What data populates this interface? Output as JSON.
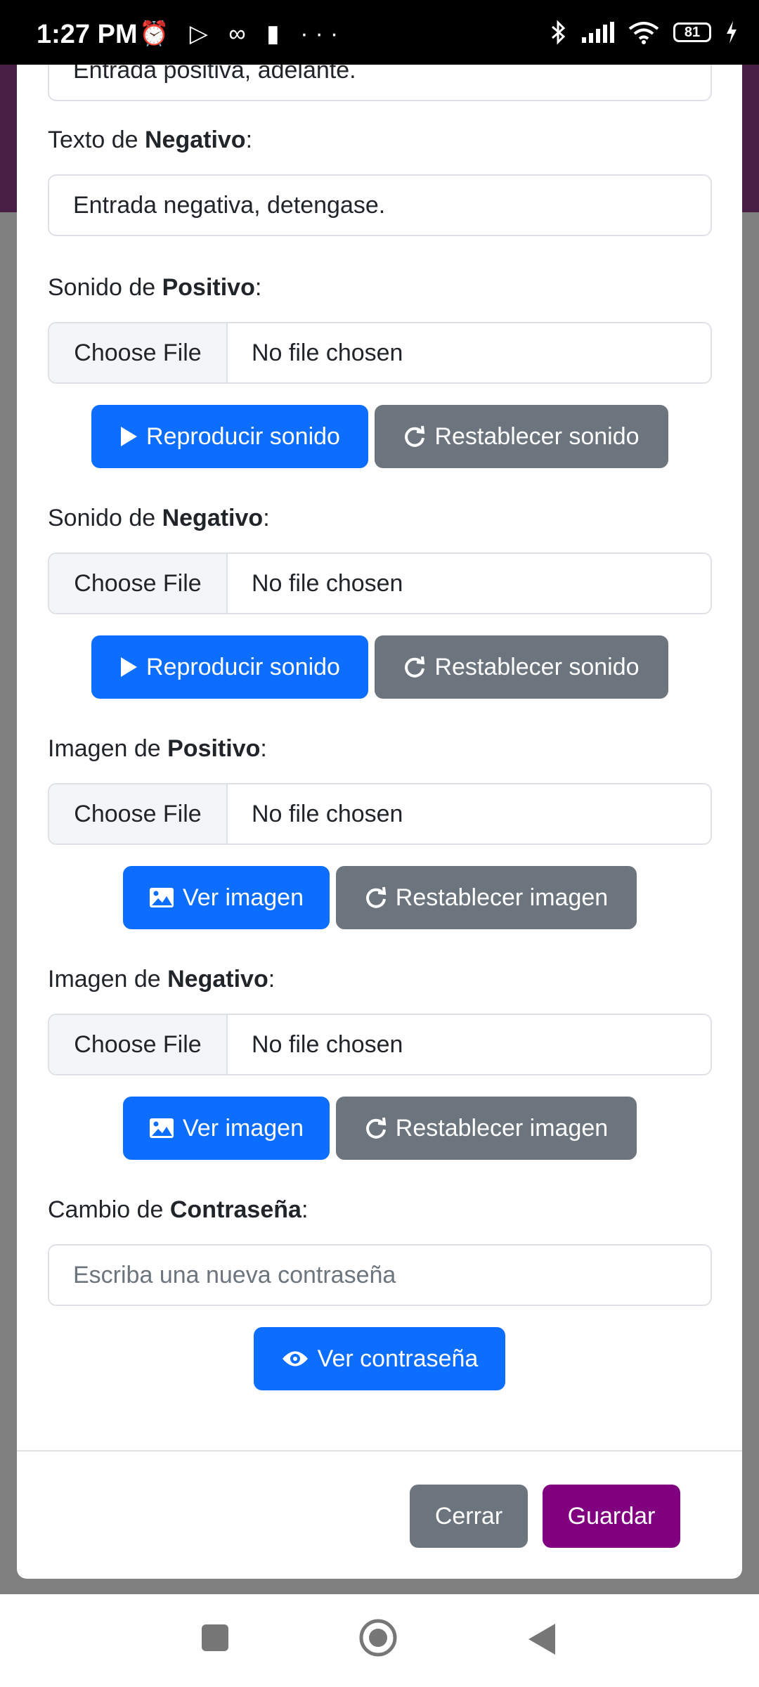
{
  "status_bar": {
    "time": "1:27 PM",
    "left_icons": "⏰ ▷ ∞ ▮ ···",
    "battery": "81"
  },
  "form": {
    "top_partial_value": "Entrada positiva, adelante.",
    "texto_negativo": {
      "label_prefix": "Texto de ",
      "label_bold": "Negativo",
      "label_suffix": ":",
      "value": "Entrada negativa, detengase."
    },
    "sonido_positivo": {
      "label_prefix": "Sonido de ",
      "label_bold": "Positivo",
      "label_suffix": ":",
      "choose": "Choose File",
      "status": "No file chosen",
      "play": "Reproducir sonido",
      "reset": "Restablecer sonido"
    },
    "sonido_negativo": {
      "label_prefix": "Sonido de ",
      "label_bold": "Negativo",
      "label_suffix": ":",
      "choose": "Choose File",
      "status": "No file chosen",
      "play": "Reproducir sonido",
      "reset": "Restablecer sonido"
    },
    "imagen_positivo": {
      "label_prefix": "Imagen de ",
      "label_bold": "Positivo",
      "label_suffix": ":",
      "choose": "Choose File",
      "status": "No file chosen",
      "view": "Ver imagen",
      "reset": "Restablecer imagen"
    },
    "imagen_negativo": {
      "label_prefix": "Imagen de ",
      "label_bold": "Negativo",
      "label_suffix": ":",
      "choose": "Choose File",
      "status": "No file chosen",
      "view": "Ver imagen",
      "reset": "Restablecer imagen"
    },
    "password": {
      "label_prefix": "Cambio de ",
      "label_bold": "Contraseña",
      "label_suffix": ":",
      "placeholder": "Escriba una nueva contraseña",
      "view": "Ver contraseña"
    }
  },
  "footer": {
    "close": "Cerrar",
    "save": "Guardar"
  },
  "colors": {
    "primary": "#0d6efd",
    "secondary": "#6c757d",
    "save": "#800080",
    "header_bg": "#4a1f46"
  },
  "icons": [
    "play-icon",
    "reset-icon",
    "image-icon",
    "eye-icon",
    "square-nav-icon",
    "home-nav-icon",
    "back-nav-icon",
    "bluetooth-icon",
    "signal-icon",
    "wifi-icon",
    "battery-icon",
    "charging-icon"
  ]
}
